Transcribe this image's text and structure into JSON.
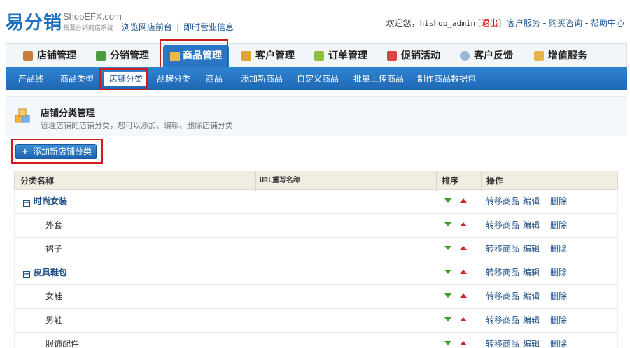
{
  "header": {
    "logo_main": "易分销",
    "logo_site": "ShopEFX.com",
    "logo_tagline": "货源分销网店系统",
    "links": [
      "浏览网店前台",
      "即时营业信息"
    ],
    "welcome": "欢迎您，",
    "username": "hishop_admin",
    "logout_open": "[",
    "logout": "退出",
    "logout_close": "]",
    "service_links": [
      "客户服务",
      "购买咨询",
      "帮助中心"
    ],
    "dash": "-"
  },
  "main_nav": [
    {
      "label": "店铺管理",
      "icon": "house-icon"
    },
    {
      "label": "分销管理",
      "icon": "network-icon"
    },
    {
      "label": "商品管理",
      "icon": "box-icon",
      "active": true
    },
    {
      "label": "客户管理",
      "icon": "contact-card-icon"
    },
    {
      "label": "订单管理",
      "icon": "order-icon"
    },
    {
      "label": "促销活动",
      "icon": "promotion-icon"
    },
    {
      "label": "客户反馈",
      "icon": "speech-bubble-icon"
    },
    {
      "label": "增值服务",
      "icon": "gift-bag-icon"
    }
  ],
  "sub_nav": [
    {
      "label": "产品线"
    },
    {
      "label": "商品类型"
    },
    {
      "label": "店铺分类",
      "active": true
    },
    {
      "label": "品牌分类"
    },
    {
      "label": "商品"
    },
    {
      "label": "添加新商品"
    },
    {
      "label": "自定义商品"
    },
    {
      "label": "批量上传商品"
    },
    {
      "label": "制作商品数据包"
    }
  ],
  "page": {
    "title": "店铺分类管理",
    "description": "管理店铺的店铺分类，您可以添加、编辑、删除店铺分类",
    "add_button": "添加新店铺分类"
  },
  "table": {
    "columns": [
      "分类名称",
      "URL重写名称",
      "排序",
      "操作"
    ],
    "actions": [
      "转移商品",
      "编辑",
      "删除"
    ],
    "rows": [
      {
        "name": "时尚女装",
        "level": "parent"
      },
      {
        "name": "外套",
        "level": "child"
      },
      {
        "name": "裙子",
        "level": "child"
      },
      {
        "name": "皮具鞋包",
        "level": "parent"
      },
      {
        "name": "女鞋",
        "level": "child"
      },
      {
        "name": "男鞋",
        "level": "child"
      },
      {
        "name": "服饰配件",
        "level": "child"
      }
    ]
  },
  "colors": {
    "nav_active": "#2a76c4",
    "subnav_bg": "#1f67b3",
    "highlight_box": "#d21b1b",
    "sort_down": "#3c9b2a",
    "sort_up": "#d0252b"
  }
}
